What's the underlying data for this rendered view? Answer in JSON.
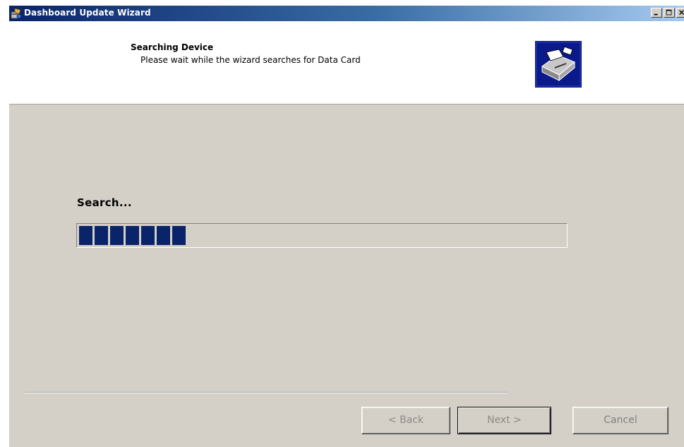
{
  "window": {
    "title": "Dashboard Update Wizard",
    "icon": "installer-app-icon",
    "controls": [
      "minimize-icon",
      "maximize-icon",
      "close-icon"
    ]
  },
  "header": {
    "title": "Searching Device",
    "subtitle": "Please wait while the wizard searches for Data Card",
    "graphic": "install-device-icon"
  },
  "status": {
    "label": "Search...",
    "progress_blocks_filled": 7
  },
  "buttons": {
    "back": "< Back",
    "next": "Next >",
    "cancel": "Cancel"
  },
  "colors": {
    "titlebar_start": "#0a246a",
    "titlebar_end": "#a6caf0",
    "progress_fill": "#0a246a",
    "dialog_face": "#d4d0c8"
  }
}
